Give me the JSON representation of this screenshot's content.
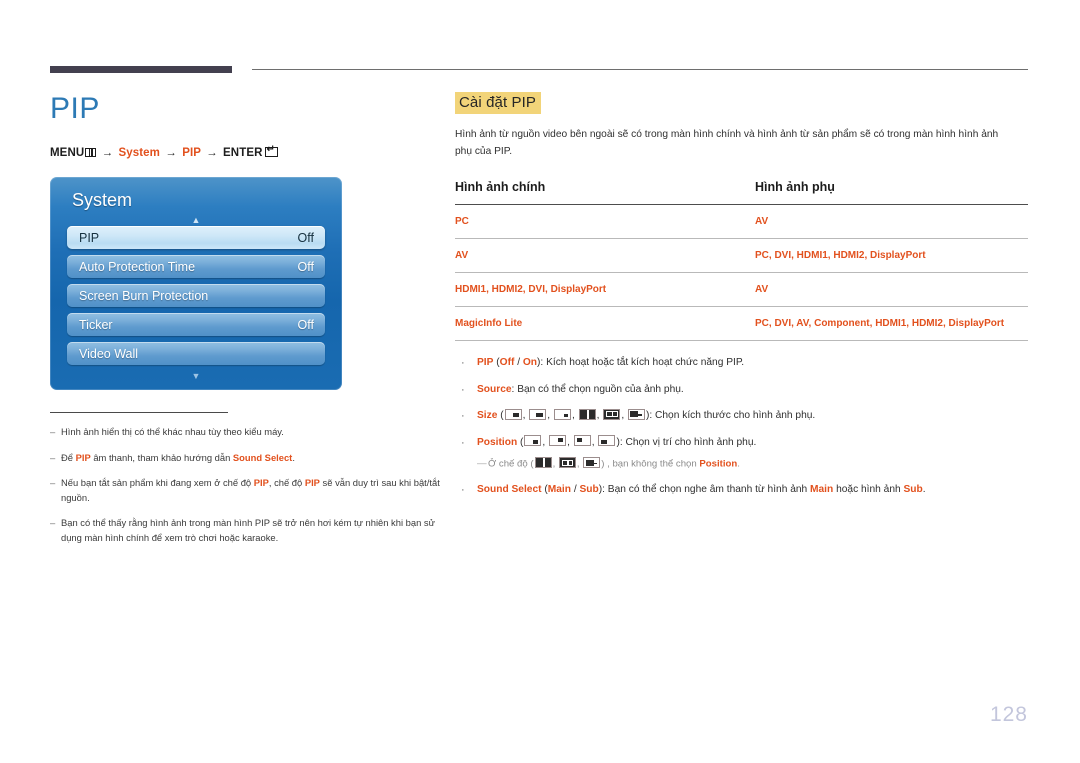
{
  "header": {
    "bar_color": "#43404f",
    "line_color": "#6e6e6e"
  },
  "left": {
    "page_title": "PIP",
    "title_color": "#2d7ab5",
    "menu_path": {
      "menu_label": "MENU",
      "arrow": "→",
      "item1": "System",
      "item2": "PIP",
      "enter_label": "ENTER"
    },
    "osd": {
      "title": "System",
      "up_arrow": "▲",
      "down_arrow": "▼",
      "rows": [
        {
          "label": "PIP",
          "value": "Off",
          "selected": true
        },
        {
          "label": "Auto Protection Time",
          "value": "Off",
          "selected": false
        },
        {
          "label": "Screen Burn Protection",
          "value": "",
          "selected": false
        },
        {
          "label": "Ticker",
          "value": "Off",
          "selected": false
        },
        {
          "label": "Video Wall",
          "value": "",
          "selected": false
        }
      ]
    },
    "footnotes": [
      {
        "dash": "–",
        "text": "Hình ảnh hiển thị có thể khác nhau tùy theo kiểu máy."
      },
      {
        "dash": "–",
        "text": "Để <b>PIP</b> âm thanh, tham khảo hướng dẫn <b>Sound Select</b>."
      },
      {
        "dash": "–",
        "text": "Nếu bạn tắt sản phẩm khi đang xem ở chế độ <b>PIP</b>, chế độ <b>PIP</b> sẽ vẫn duy trì sau khi bật/tắt nguồn."
      },
      {
        "dash": "–",
        "text": "Bạn có thể thấy rằng hình ảnh trong màn hình PIP sẽ trở nên hơi kém tự nhiên khi bạn sử dụng màn hình chính để xem trò chơi hoặc karaoke."
      }
    ]
  },
  "right": {
    "section_title": "Cài đặt PIP",
    "section_title_bg": "#f2d479",
    "intro": "Hình ảnh từ nguồn video bên ngoài sẽ có trong màn hình chính và hình ảnh từ sản phẩm sẽ có trong màn hình hình ảnh phụ của PIP.",
    "table": {
      "headers": [
        "Hình ảnh chính",
        "Hình ảnh phụ"
      ],
      "rows": [
        {
          "main": "PC",
          "sub": "AV"
        },
        {
          "main": "AV",
          "sub": "PC, DVI, HDMI1, HDMI2, DisplayPort"
        },
        {
          "main": "HDMI1, HDMI2, DVI, DisplayPort",
          "sub": "AV"
        },
        {
          "main": "MagicInfo Lite",
          "sub": "PC, DVI, AV, Component, HDMI1, HDMI2, DisplayPort"
        }
      ],
      "value_color": "#e2511e"
    },
    "bullets": [
      {
        "dot": "·",
        "html": "<b>PIP</b> (<b>Off</b> / <b>On</b>): Kích hoạt hoặc tắt kích hoạt chức năng PIP."
      },
      {
        "dot": "·",
        "html": "<b>Source</b>: Bạn có thể chọn nguồn của ảnh phụ."
      },
      {
        "dot": "·",
        "html": "<b>Size</b> (__ICONS_SIZE__): Chọn kích thước cho hình ảnh phụ."
      },
      {
        "dot": "·",
        "html": "<b>Position</b> (__ICONS_POS__): Chọn vị trí cho hình ảnh phụ."
      }
    ],
    "subnote": {
      "dash": "—",
      "html": "Ở chế độ (__ICONS_SPLIT__) , bạn không thể chọn <b>Position</b>."
    },
    "bullet_last": {
      "dot": "·",
      "html": "<b>Sound Select</b> (<b>Main</b> / <b>Sub</b>): Bạn có thể chọn nghe âm thanh từ hình ảnh <b>Main</b> hoặc hình ảnh <b>Sub</b>."
    },
    "icon_names": {
      "size": [
        "pip-size-small-icon",
        "pip-size-medium-icon",
        "pip-size-tiny-icon",
        "pip-split-half-icon",
        "pip-split-double-icon",
        "pip-split-wide-icon"
      ],
      "position": [
        "pip-position-bottom-right-icon",
        "pip-position-top-right-icon",
        "pip-position-top-left-icon",
        "pip-position-bottom-left-icon"
      ],
      "split": [
        "pip-split-half-icon",
        "pip-split-double-icon",
        "pip-split-wide-icon"
      ]
    }
  },
  "footer": {
    "page_number": "128"
  }
}
